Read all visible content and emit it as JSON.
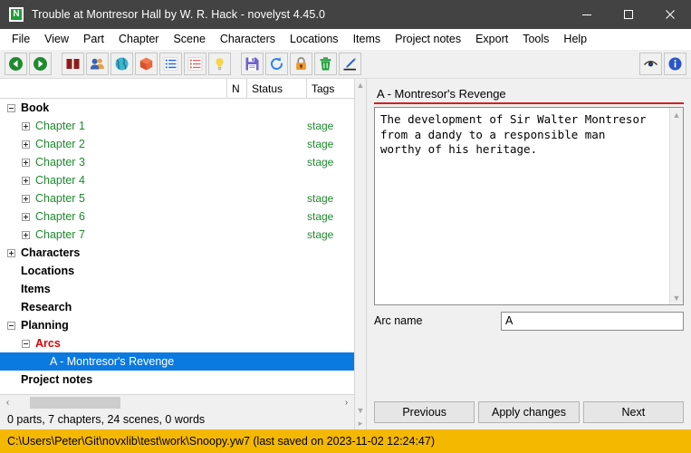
{
  "window": {
    "title": "Trouble at Montresor Hall by W. R. Hack - novelyst 4.45.0",
    "app_icon_letter": "N",
    "minimize_label": "Minimize",
    "maximize_label": "Maximize",
    "close_label": "Close"
  },
  "menubar": {
    "items": [
      {
        "label": "File"
      },
      {
        "label": "View"
      },
      {
        "label": "Part"
      },
      {
        "label": "Chapter"
      },
      {
        "label": "Scene"
      },
      {
        "label": "Characters"
      },
      {
        "label": "Locations"
      },
      {
        "label": "Items"
      },
      {
        "label": "Project notes"
      },
      {
        "label": "Export"
      },
      {
        "label": "Tools"
      },
      {
        "label": "Help"
      }
    ]
  },
  "toolbar": {
    "buttons": [
      {
        "name": "go-back-icon",
        "title": "Go back"
      },
      {
        "name": "go-forward-icon",
        "title": "Go forward"
      },
      {
        "name": "book-icon",
        "title": "Book"
      },
      {
        "name": "characters-icon",
        "title": "Characters"
      },
      {
        "name": "locations-icon",
        "title": "Locations"
      },
      {
        "name": "items-icon",
        "title": "Items"
      },
      {
        "name": "research-icon",
        "title": "Research"
      },
      {
        "name": "planning-icon",
        "title": "Planning"
      },
      {
        "name": "project-notes-icon",
        "title": "Project notes"
      },
      {
        "name": "save-icon",
        "title": "Save"
      },
      {
        "name": "reload-icon",
        "title": "Reload"
      },
      {
        "name": "lock-icon",
        "title": "Lock project"
      },
      {
        "name": "delete-icon",
        "title": "Delete"
      },
      {
        "name": "edit-icon",
        "title": "Edit"
      }
    ],
    "right_buttons": [
      {
        "name": "view-toggle-icon",
        "title": "Toggle properties view"
      },
      {
        "name": "info-icon",
        "title": "About"
      }
    ]
  },
  "tree": {
    "columns": [
      {
        "label": "N"
      },
      {
        "label": "Status"
      },
      {
        "label": "Tags"
      }
    ],
    "rows": [
      {
        "label": "Book",
        "level": 0,
        "expander": "minus",
        "color": "black",
        "tag": ""
      },
      {
        "label": "Chapter 1",
        "level": 1,
        "expander": "plus",
        "color": "green",
        "tag": "stage"
      },
      {
        "label": "Chapter 2",
        "level": 1,
        "expander": "plus",
        "color": "green",
        "tag": "stage"
      },
      {
        "label": "Chapter 3",
        "level": 1,
        "expander": "plus",
        "color": "green",
        "tag": "stage"
      },
      {
        "label": "Chapter 4",
        "level": 1,
        "expander": "plus",
        "color": "green",
        "tag": ""
      },
      {
        "label": "Chapter 5",
        "level": 1,
        "expander": "plus",
        "color": "green",
        "tag": "stage"
      },
      {
        "label": "Chapter 6",
        "level": 1,
        "expander": "plus",
        "color": "green",
        "tag": "stage"
      },
      {
        "label": "Chapter 7",
        "level": 1,
        "expander": "plus",
        "color": "green",
        "tag": "stage"
      },
      {
        "label": "Characters",
        "level": 0,
        "expander": "plus",
        "color": "black",
        "tag": ""
      },
      {
        "label": "Locations",
        "level": 0,
        "expander": "none",
        "color": "black",
        "tag": ""
      },
      {
        "label": "Items",
        "level": 0,
        "expander": "none",
        "color": "black",
        "tag": ""
      },
      {
        "label": "Research",
        "level": 0,
        "expander": "none",
        "color": "black",
        "tag": ""
      },
      {
        "label": "Planning",
        "level": 0,
        "expander": "minus",
        "color": "black",
        "tag": ""
      },
      {
        "label": "Arcs",
        "level": 1,
        "expander": "minus",
        "color": "red",
        "tag": ""
      },
      {
        "label": "A - Montresor's Revenge",
        "level": 2,
        "expander": "none",
        "color": "white",
        "tag": "",
        "selected": true
      },
      {
        "label": "Project notes",
        "level": 0,
        "expander": "none",
        "color": "black",
        "tag": ""
      }
    ]
  },
  "left_status": {
    "summary": "0 parts, 7 chapters, 24 scenes, 0 words",
    "scroll_left_arrow": "‹",
    "scroll_right_arrow": "›"
  },
  "properties": {
    "title": "A - Montresor's Revenge",
    "description": "The development of Sir Walter Montresor\nfrom a dandy to a responsible man\nworthy of his heritage.",
    "arc_name_label": "Arc name",
    "arc_name_value": "A",
    "buttons": {
      "previous": "Previous",
      "apply": "Apply changes",
      "next": "Next"
    }
  },
  "pathbar": {
    "text": "C:\\Users\\Peter\\Git\\novxlib\\test\\work\\Snoopy.yw7 (last saved on 2023-11-02 12:24:47)"
  },
  "colors": {
    "titlebar_bg": "#434343",
    "selection_blue": "#0a7ae0",
    "tag_green": "#1f8a2e",
    "arcs_red": "#e00000",
    "title_underline_red": "#d32020",
    "pathbar_orange": "#f5b800"
  }
}
